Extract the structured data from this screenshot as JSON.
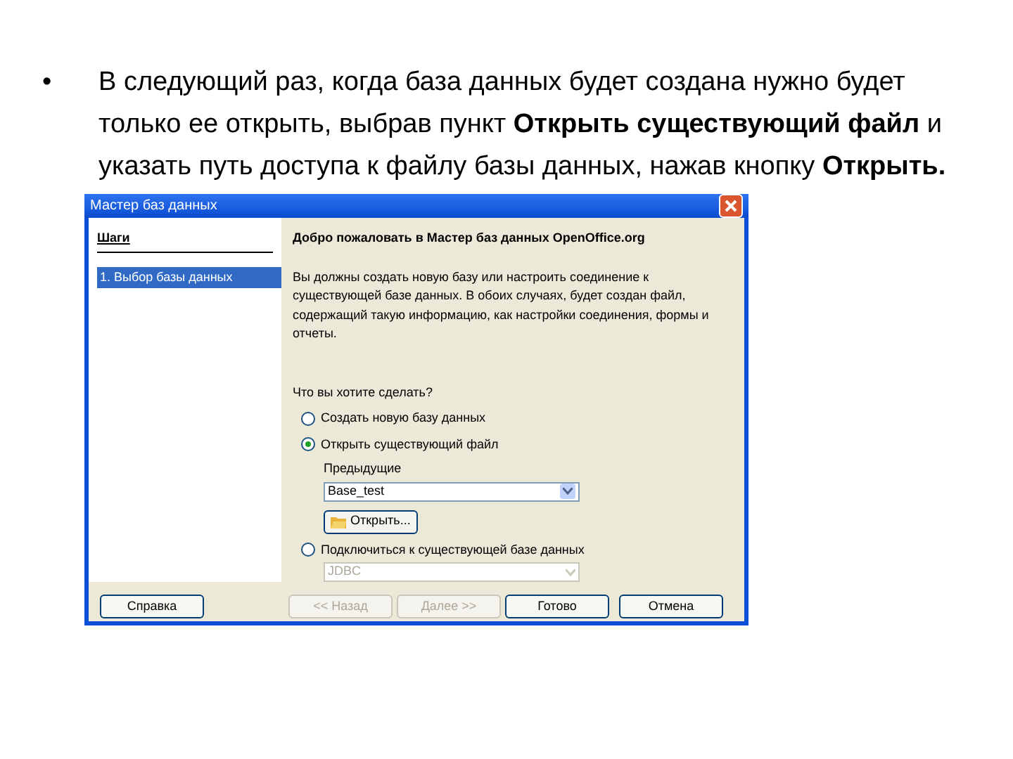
{
  "slide": {
    "bullet": "•",
    "text": "В следующий раз, когда база данных будет создана нужно будет только ее открыть, выбрав пункт **Открыть существующий файл** и указать путь доступа к файлу базы данных, нажав кнопку **Открыть.**"
  },
  "dialog": {
    "title": "Мастер баз данных",
    "steps_heading": "Шаги",
    "steps": [
      {
        "label": "1. Выбор базы данных",
        "selected": true
      }
    ],
    "heading": "Добро пожаловать в Мастер баз данных OpenOffice.org",
    "description": "Вы должны создать новую базу или настроить соединение к существующей базе данных. В обоих случаях, будет создан файл, содержащий такую информацию, как настройки соединения, формы и отчеты.",
    "question": "Что вы хотите сделать?",
    "options": [
      {
        "label": "Создать новую базу данных",
        "selected": false
      },
      {
        "label": "Открыть существующий файл",
        "selected": true,
        "recent_label": "Предыдущие",
        "recent_value": "Base_test",
        "open_button": "Открыть..."
      },
      {
        "label": "Подключиться к существующей базе данных",
        "selected": false,
        "driver": {
          "value": "JDBC",
          "disabled": true
        }
      }
    ],
    "buttons": [
      {
        "label": "Справка",
        "disabled": false
      },
      {
        "label": "<< Назад",
        "disabled": true
      },
      {
        "label": "Далее >>",
        "disabled": true
      },
      {
        "label": "Готово",
        "disabled": false
      },
      {
        "label": "Отмена",
        "disabled": false
      }
    ]
  }
}
